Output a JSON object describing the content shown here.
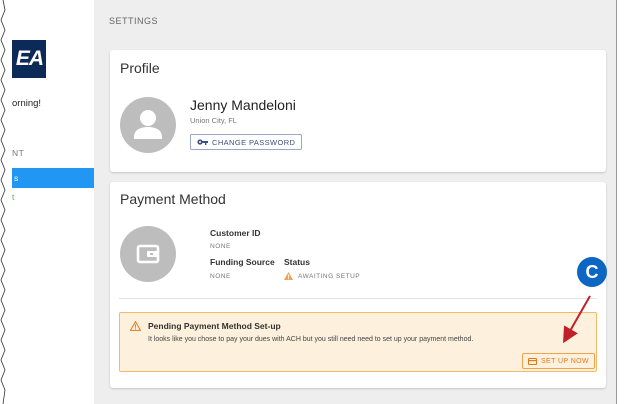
{
  "sidebar": {
    "logo_text": "EA",
    "greeting": "orning!",
    "section_label": "NT",
    "active_item": "s",
    "item": "t"
  },
  "main": {
    "page_title": "SETTINGS"
  },
  "profile": {
    "title": "Profile",
    "name": "Jenny Mandeloni",
    "location": "Union City, FL",
    "change_password_label": "CHANGE PASSWORD"
  },
  "payment": {
    "title": "Payment Method",
    "customer_id_label": "Customer ID",
    "customer_id_value": "NONE",
    "funding_source_label": "Funding Source",
    "funding_source_value": "NONE",
    "status_label": "Status",
    "status_value": "AWAITING SETUP"
  },
  "alert": {
    "title": "Pending Payment Method Set-up",
    "text": "It looks like you chose to pay your dues with ACH but you still need need to set up your payment method.",
    "button_label": "SET UP NOW"
  },
  "callout": {
    "label": "C"
  },
  "colors": {
    "accent": "#2196f3",
    "logo_bg": "#0b2a57",
    "warning": "#f2a24f",
    "marker": "#0d66c2",
    "arrow": "#c0202a"
  },
  "icons": {
    "avatar": "person-icon",
    "key": "key-icon",
    "wallet": "wallet-icon",
    "warning": "warning-icon",
    "card": "credit-card-icon"
  }
}
